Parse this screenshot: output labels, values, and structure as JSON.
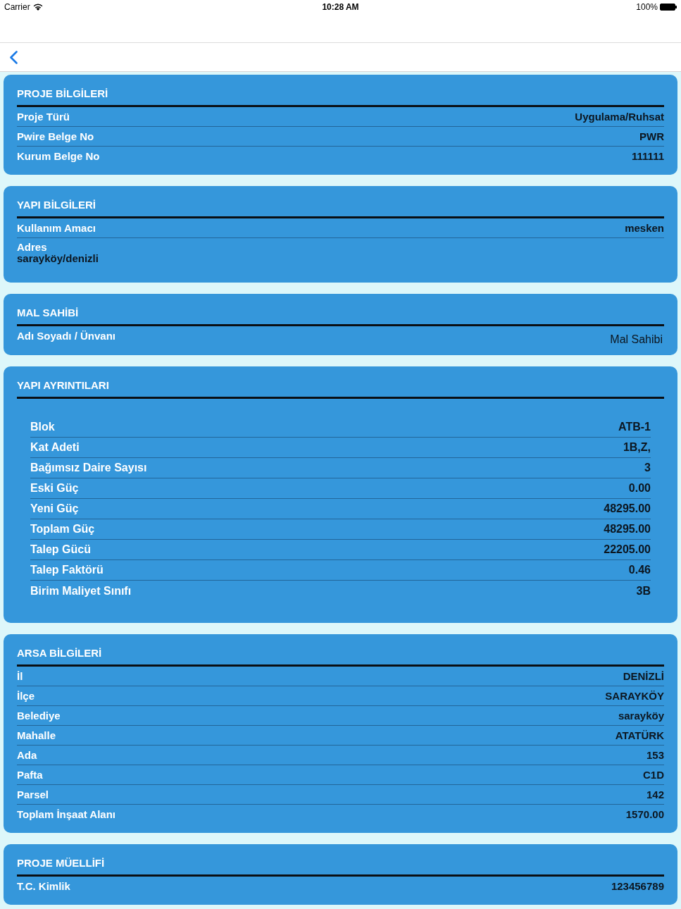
{
  "status_bar": {
    "carrier": "Carrier",
    "time": "10:28 AM",
    "battery": "100%"
  },
  "sections": [
    {
      "title": "PROJE BİLGİLERİ",
      "kind": "flat",
      "rows": [
        {
          "kind": "inline",
          "label": "Proje Türü",
          "value": "Uygulama/Ruhsat"
        },
        {
          "kind": "inline",
          "label": "Pwire Belge No",
          "value": "PWR"
        },
        {
          "kind": "inline",
          "label": "Kurum Belge No",
          "value": "111111"
        }
      ]
    },
    {
      "title": "YAPI BİLGİLERİ",
      "kind": "flat",
      "rows": [
        {
          "kind": "inline",
          "label": "Kullanım Amacı",
          "value": "mesken"
        },
        {
          "kind": "stacked",
          "label": "Adres",
          "value": "sarayköy/denizli"
        }
      ]
    },
    {
      "title": "MAL SAHİBİ",
      "kind": "flat",
      "rows": [
        {
          "kind": "offset",
          "label": "Adı Soyadı / Ünvanı",
          "value": "Mal Sahibi"
        }
      ]
    },
    {
      "title": "YAPI AYRINTILARI",
      "kind": "indented",
      "rows": [
        {
          "kind": "inline",
          "label": "Blok",
          "value": "ATB-1"
        },
        {
          "kind": "inline",
          "label": "Kat Adeti",
          "value": "1B,Z,"
        },
        {
          "kind": "inline",
          "label": "Bağımsız Daire Sayısı",
          "value": "3"
        },
        {
          "kind": "inline",
          "label": "Eski Güç",
          "value": "0.00"
        },
        {
          "kind": "inline",
          "label": "Yeni Güç",
          "value": "48295.00"
        },
        {
          "kind": "inline",
          "label": "Toplam Güç",
          "value": "48295.00"
        },
        {
          "kind": "inline",
          "label": "Talep Gücü",
          "value": "22205.00"
        },
        {
          "kind": "inline",
          "label": "Talep Faktörü",
          "value": "0.46"
        },
        {
          "kind": "inline",
          "label": "Birim Maliyet Sınıfı",
          "value": "3B"
        }
      ]
    },
    {
      "title": "ARSA BİLGİLERİ",
      "kind": "flat",
      "rows": [
        {
          "kind": "inline",
          "label": "İl",
          "value": "DENİZLİ"
        },
        {
          "kind": "inline",
          "label": "İlçe",
          "value": "SARAYKÖY"
        },
        {
          "kind": "inline",
          "label": "Belediye",
          "value": "sarayköy"
        },
        {
          "kind": "inline",
          "label": "Mahalle",
          "value": "ATATÜRK"
        },
        {
          "kind": "inline",
          "label": "Ada",
          "value": "153"
        },
        {
          "kind": "inline",
          "label": "Pafta",
          "value": "C1D"
        },
        {
          "kind": "inline",
          "label": "Parsel",
          "value": "142"
        },
        {
          "kind": "inline",
          "label": "Toplam İnşaat Alanı",
          "value": "1570.00"
        }
      ]
    },
    {
      "title": "PROJE MÜELLİFİ",
      "kind": "flat",
      "rows": [
        {
          "kind": "inline",
          "label": "T.C. Kimlik",
          "value": "123456789"
        }
      ]
    }
  ]
}
